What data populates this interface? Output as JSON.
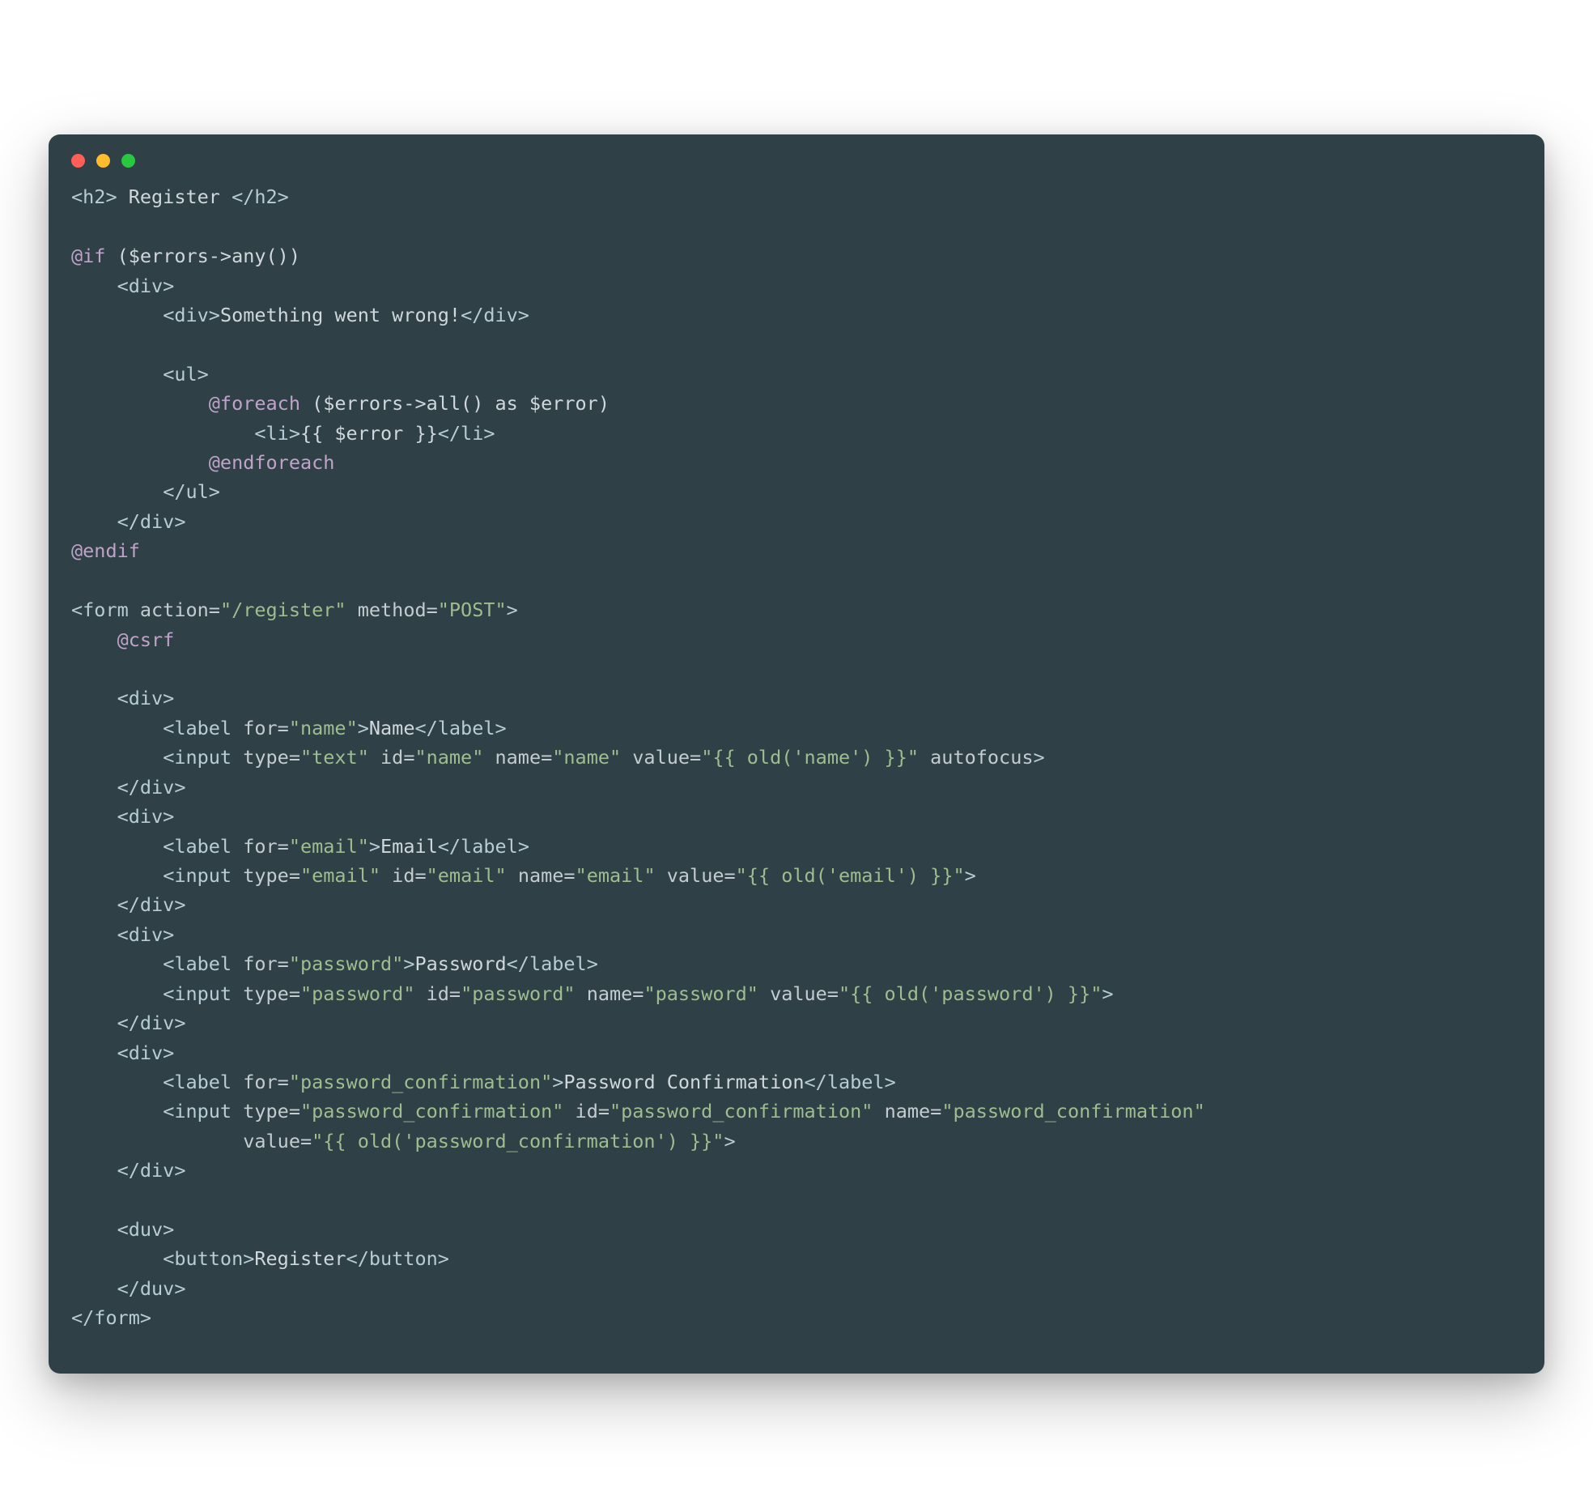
{
  "colors": {
    "background": "#2f4047",
    "tag": "#b7ccd4",
    "text": "#cfd8dc",
    "string": "#9fbd8f",
    "directive": "#bfa3c9",
    "dot_red": "#ff5f57",
    "dot_yellow": "#febc2e",
    "dot_green": "#28c840"
  },
  "code": {
    "lines": [
      [
        {
          "t": "tag",
          "v": "<h2>"
        },
        {
          "t": "text",
          "v": " Register "
        },
        {
          "t": "tag",
          "v": "</h2>"
        }
      ],
      [],
      [
        {
          "t": "dir",
          "v": "@if"
        },
        {
          "t": "text",
          "v": " ($errors->any())"
        }
      ],
      [
        {
          "t": "text",
          "v": "    "
        },
        {
          "t": "tag",
          "v": "<div>"
        }
      ],
      [
        {
          "t": "text",
          "v": "        "
        },
        {
          "t": "tag",
          "v": "<div>"
        },
        {
          "t": "text",
          "v": "Something went wrong!"
        },
        {
          "t": "tag",
          "v": "</div>"
        }
      ],
      [],
      [
        {
          "t": "text",
          "v": "        "
        },
        {
          "t": "tag",
          "v": "<ul>"
        }
      ],
      [
        {
          "t": "text",
          "v": "            "
        },
        {
          "t": "dir",
          "v": "@foreach"
        },
        {
          "t": "text",
          "v": " ($errors->all() as $error)"
        }
      ],
      [
        {
          "t": "text",
          "v": "                "
        },
        {
          "t": "tag",
          "v": "<li>"
        },
        {
          "t": "text",
          "v": "{{ $error }}"
        },
        {
          "t": "tag",
          "v": "</li>"
        }
      ],
      [
        {
          "t": "text",
          "v": "            "
        },
        {
          "t": "dir",
          "v": "@endforeach"
        }
      ],
      [
        {
          "t": "text",
          "v": "        "
        },
        {
          "t": "tag",
          "v": "</ul>"
        }
      ],
      [
        {
          "t": "text",
          "v": "    "
        },
        {
          "t": "tag",
          "v": "</div>"
        }
      ],
      [
        {
          "t": "dir",
          "v": "@endif"
        }
      ],
      [],
      [
        {
          "t": "tag",
          "v": "<form "
        },
        {
          "t": "attr",
          "v": "action="
        },
        {
          "t": "str",
          "v": "\"/register\""
        },
        {
          "t": "attr",
          "v": " method="
        },
        {
          "t": "str",
          "v": "\"POST\""
        },
        {
          "t": "tag",
          "v": ">"
        }
      ],
      [
        {
          "t": "text",
          "v": "    "
        },
        {
          "t": "dir",
          "v": "@csrf"
        }
      ],
      [],
      [
        {
          "t": "text",
          "v": "    "
        },
        {
          "t": "tag",
          "v": "<div>"
        }
      ],
      [
        {
          "t": "text",
          "v": "        "
        },
        {
          "t": "tag",
          "v": "<label "
        },
        {
          "t": "attr",
          "v": "for="
        },
        {
          "t": "str",
          "v": "\"name\""
        },
        {
          "t": "tag",
          "v": ">"
        },
        {
          "t": "text",
          "v": "Name"
        },
        {
          "t": "tag",
          "v": "</label>"
        }
      ],
      [
        {
          "t": "text",
          "v": "        "
        },
        {
          "t": "tag",
          "v": "<input "
        },
        {
          "t": "attr",
          "v": "type="
        },
        {
          "t": "str",
          "v": "\"text\""
        },
        {
          "t": "attr",
          "v": " id="
        },
        {
          "t": "str",
          "v": "\"name\""
        },
        {
          "t": "attr",
          "v": " name="
        },
        {
          "t": "str",
          "v": "\"name\""
        },
        {
          "t": "attr",
          "v": " value="
        },
        {
          "t": "str",
          "v": "\"{{ old('name') }}\""
        },
        {
          "t": "attr",
          "v": " autofocus"
        },
        {
          "t": "tag",
          "v": ">"
        }
      ],
      [
        {
          "t": "text",
          "v": "    "
        },
        {
          "t": "tag",
          "v": "</div>"
        }
      ],
      [
        {
          "t": "text",
          "v": "    "
        },
        {
          "t": "tag",
          "v": "<div>"
        }
      ],
      [
        {
          "t": "text",
          "v": "        "
        },
        {
          "t": "tag",
          "v": "<label "
        },
        {
          "t": "attr",
          "v": "for="
        },
        {
          "t": "str",
          "v": "\"email\""
        },
        {
          "t": "tag",
          "v": ">"
        },
        {
          "t": "text",
          "v": "Email"
        },
        {
          "t": "tag",
          "v": "</label>"
        }
      ],
      [
        {
          "t": "text",
          "v": "        "
        },
        {
          "t": "tag",
          "v": "<input "
        },
        {
          "t": "attr",
          "v": "type="
        },
        {
          "t": "str",
          "v": "\"email\""
        },
        {
          "t": "attr",
          "v": " id="
        },
        {
          "t": "str",
          "v": "\"email\""
        },
        {
          "t": "attr",
          "v": " name="
        },
        {
          "t": "str",
          "v": "\"email\""
        },
        {
          "t": "attr",
          "v": " value="
        },
        {
          "t": "str",
          "v": "\"{{ old('email') }}\""
        },
        {
          "t": "tag",
          "v": ">"
        }
      ],
      [
        {
          "t": "text",
          "v": "    "
        },
        {
          "t": "tag",
          "v": "</div>"
        }
      ],
      [
        {
          "t": "text",
          "v": "    "
        },
        {
          "t": "tag",
          "v": "<div>"
        }
      ],
      [
        {
          "t": "text",
          "v": "        "
        },
        {
          "t": "tag",
          "v": "<label "
        },
        {
          "t": "attr",
          "v": "for="
        },
        {
          "t": "str",
          "v": "\"password\""
        },
        {
          "t": "tag",
          "v": ">"
        },
        {
          "t": "text",
          "v": "Password"
        },
        {
          "t": "tag",
          "v": "</label>"
        }
      ],
      [
        {
          "t": "text",
          "v": "        "
        },
        {
          "t": "tag",
          "v": "<input "
        },
        {
          "t": "attr",
          "v": "type="
        },
        {
          "t": "str",
          "v": "\"password\""
        },
        {
          "t": "attr",
          "v": " id="
        },
        {
          "t": "str",
          "v": "\"password\""
        },
        {
          "t": "attr",
          "v": " name="
        },
        {
          "t": "str",
          "v": "\"password\""
        },
        {
          "t": "attr",
          "v": " value="
        },
        {
          "t": "str",
          "v": "\"{{ old('password') }}\""
        },
        {
          "t": "tag",
          "v": ">"
        }
      ],
      [
        {
          "t": "text",
          "v": "    "
        },
        {
          "t": "tag",
          "v": "</div>"
        }
      ],
      [
        {
          "t": "text",
          "v": "    "
        },
        {
          "t": "tag",
          "v": "<div>"
        }
      ],
      [
        {
          "t": "text",
          "v": "        "
        },
        {
          "t": "tag",
          "v": "<label "
        },
        {
          "t": "attr",
          "v": "for="
        },
        {
          "t": "str",
          "v": "\"password_confirmation\""
        },
        {
          "t": "tag",
          "v": ">"
        },
        {
          "t": "text",
          "v": "Password Confirmation"
        },
        {
          "t": "tag",
          "v": "</label>"
        }
      ],
      [
        {
          "t": "text",
          "v": "        "
        },
        {
          "t": "tag",
          "v": "<input "
        },
        {
          "t": "attr",
          "v": "type="
        },
        {
          "t": "str",
          "v": "\"password_confirmation\""
        },
        {
          "t": "attr",
          "v": " id="
        },
        {
          "t": "str",
          "v": "\"password_confirmation\""
        },
        {
          "t": "attr",
          "v": " name="
        },
        {
          "t": "str",
          "v": "\"password_confirmation\""
        }
      ],
      [
        {
          "t": "text",
          "v": "               "
        },
        {
          "t": "attr",
          "v": "value="
        },
        {
          "t": "str",
          "v": "\"{{ old('password_confirmation') }}\""
        },
        {
          "t": "tag",
          "v": ">"
        }
      ],
      [
        {
          "t": "text",
          "v": "    "
        },
        {
          "t": "tag",
          "v": "</div>"
        }
      ],
      [],
      [
        {
          "t": "text",
          "v": "    "
        },
        {
          "t": "tag",
          "v": "<duv>"
        }
      ],
      [
        {
          "t": "text",
          "v": "        "
        },
        {
          "t": "tag",
          "v": "<button>"
        },
        {
          "t": "text",
          "v": "Register"
        },
        {
          "t": "tag",
          "v": "</button>"
        }
      ],
      [
        {
          "t": "text",
          "v": "    "
        },
        {
          "t": "tag",
          "v": "</duv>"
        }
      ],
      [
        {
          "t": "tag",
          "v": "</form>"
        }
      ]
    ]
  }
}
